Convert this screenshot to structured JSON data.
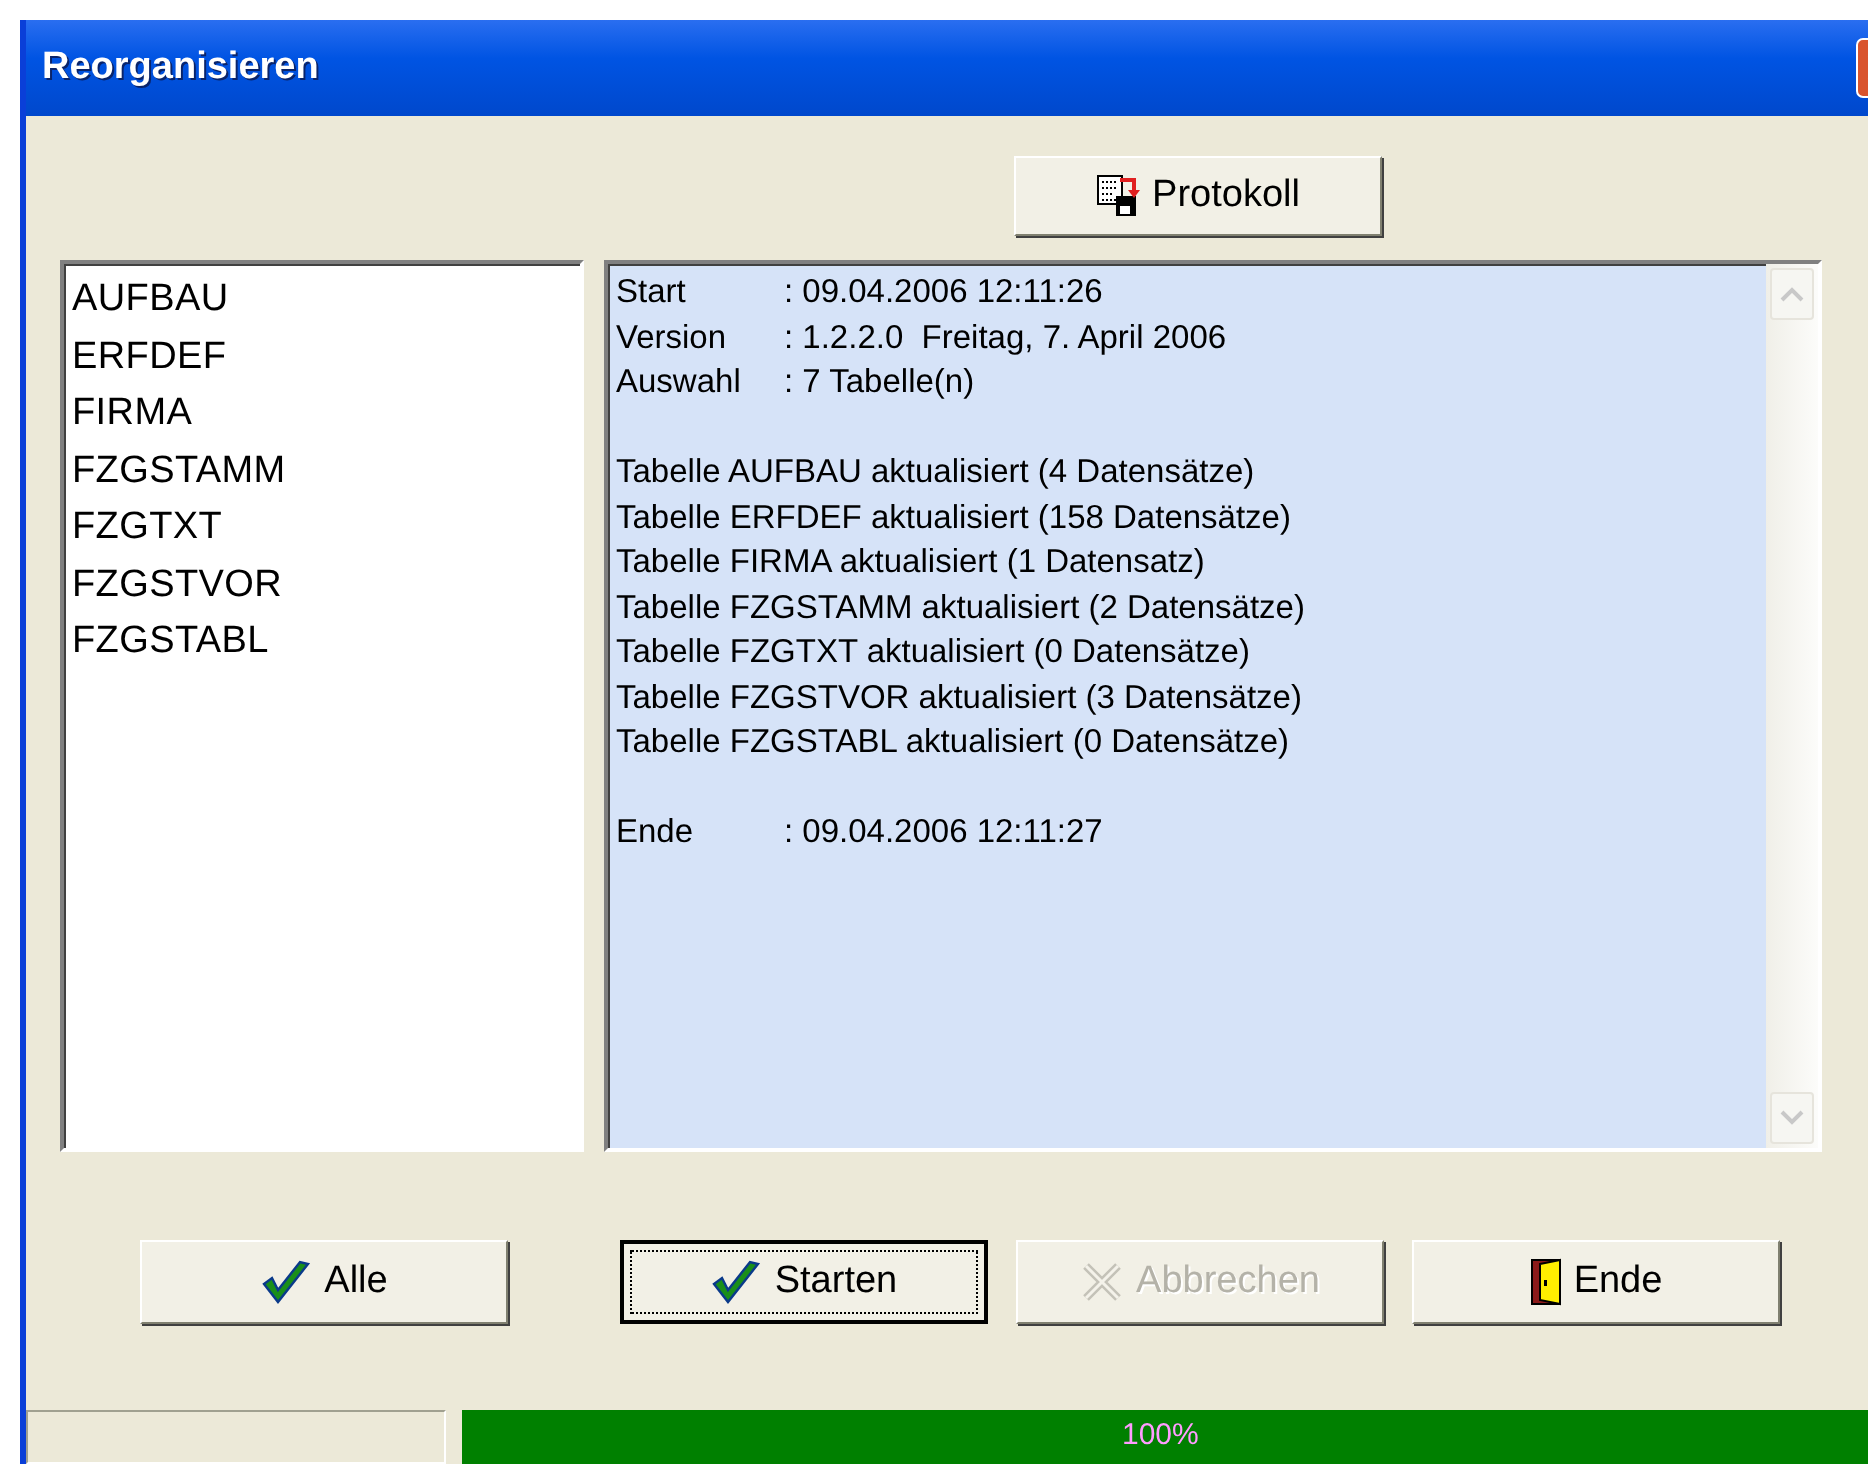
{
  "window": {
    "title": "Reorganisieren"
  },
  "toolbar": {
    "protokoll_button": {
      "label": "Protokoll"
    }
  },
  "tables_list": {
    "items": [
      "AUFBAU",
      "ERFDEF",
      "FIRMA",
      "FZGSTAMM",
      "FZGTXT",
      "FZGSTVOR",
      "FZGSTABL"
    ]
  },
  "log": {
    "header": [
      {
        "label": "Start",
        "value": ": 09.04.2006 12:11:26"
      },
      {
        "label": "Version",
        "value": ": 1.2.2.0  Freitag, 7. April 2006"
      },
      {
        "label": "Auswahl",
        "value": ": 7 Tabelle(n)"
      }
    ],
    "lines": [
      "Tabelle AUFBAU aktualisiert (4 Datensätze)",
      "Tabelle ERFDEF aktualisiert (158 Datensätze)",
      "Tabelle FIRMA aktualisiert (1 Datensatz)",
      "Tabelle FZGSTAMM aktualisiert (2 Datensätze)",
      "Tabelle FZGTXT aktualisiert (0 Datensätze)",
      "Tabelle FZGSTVOR aktualisiert (3 Datensätze)",
      "Tabelle FZGSTABL aktualisiert (0 Datensätze)"
    ],
    "footer": [
      {
        "label": "Ende",
        "value": ": 09.04.2006 12:11:27"
      }
    ]
  },
  "buttons": [
    {
      "kind": "check",
      "label": "Alle",
      "disabled": false,
      "focused": false
    },
    {
      "kind": "check",
      "label": "Starten",
      "disabled": false,
      "focused": true
    },
    {
      "kind": "cross",
      "label": "Abbrechen",
      "disabled": true,
      "focused": false
    },
    {
      "kind": "door",
      "label": "Ende",
      "disabled": false,
      "focused": false
    }
  ],
  "status_bar": {
    "progress": {
      "level": 1,
      "reading": "100%"
    }
  }
}
